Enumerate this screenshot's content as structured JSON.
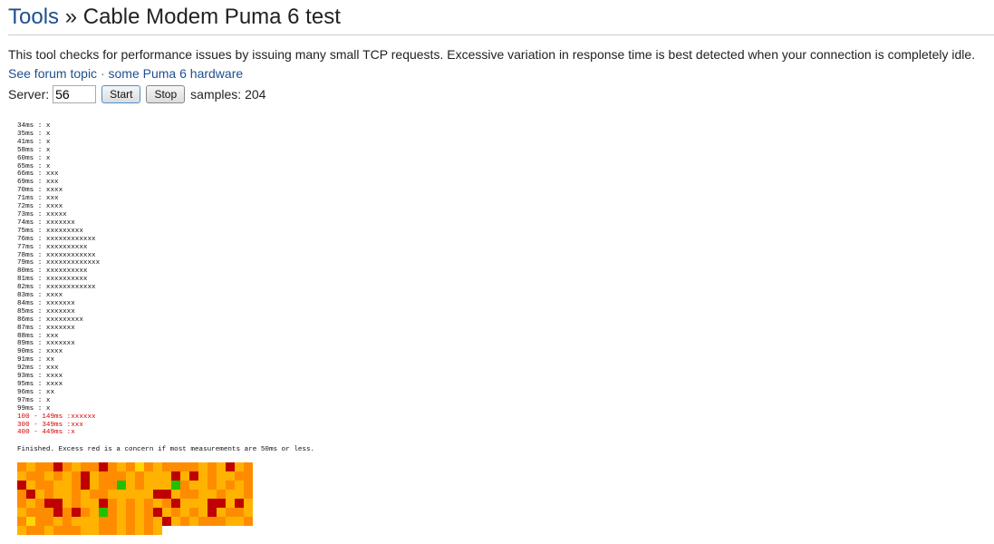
{
  "header": {
    "breadcrumb_link": "Tools",
    "separator": "»",
    "title": "Cable Modem Puma 6 test"
  },
  "description": "This tool checks for performance issues by issuing many small TCP requests. Excessive variation in response time is best detected when your connection is completely idle.",
  "links": {
    "forum": "See forum topic",
    "separator": "·",
    "hardware": "some Puma 6 hardware"
  },
  "controls": {
    "server_label": "Server:",
    "server_value": "56",
    "start_label": "Start",
    "stop_label": "Stop",
    "samples_text": "samples: 204"
  },
  "histogram": [
    {
      "ms": "34ms",
      "n": 1
    },
    {
      "ms": "35ms",
      "n": 1
    },
    {
      "ms": "41ms",
      "n": 1
    },
    {
      "ms": "58ms",
      "n": 1
    },
    {
      "ms": "60ms",
      "n": 1
    },
    {
      "ms": "65ms",
      "n": 1
    },
    {
      "ms": "66ms",
      "n": 3
    },
    {
      "ms": "69ms",
      "n": 3
    },
    {
      "ms": "70ms",
      "n": 4
    },
    {
      "ms": "71ms",
      "n": 3
    },
    {
      "ms": "72ms",
      "n": 4
    },
    {
      "ms": "73ms",
      "n": 5
    },
    {
      "ms": "74ms",
      "n": 7
    },
    {
      "ms": "75ms",
      "n": 9
    },
    {
      "ms": "76ms",
      "n": 12
    },
    {
      "ms": "77ms",
      "n": 10
    },
    {
      "ms": "78ms",
      "n": 12
    },
    {
      "ms": "79ms",
      "n": 13
    },
    {
      "ms": "80ms",
      "n": 10
    },
    {
      "ms": "81ms",
      "n": 10
    },
    {
      "ms": "82ms",
      "n": 12
    },
    {
      "ms": "83ms",
      "n": 4
    },
    {
      "ms": "84ms",
      "n": 7
    },
    {
      "ms": "85ms",
      "n": 7
    },
    {
      "ms": "86ms",
      "n": 9
    },
    {
      "ms": "87ms",
      "n": 7
    },
    {
      "ms": "88ms",
      "n": 3
    },
    {
      "ms": "89ms",
      "n": 7
    },
    {
      "ms": "90ms",
      "n": 4
    },
    {
      "ms": "91ms",
      "n": 2
    },
    {
      "ms": "92ms",
      "n": 3
    },
    {
      "ms": "93ms",
      "n": 4
    },
    {
      "ms": "95ms",
      "n": 4
    },
    {
      "ms": "96ms",
      "n": 2
    },
    {
      "ms": "97ms",
      "n": 1
    },
    {
      "ms": "99ms",
      "n": 1
    }
  ],
  "histogram_ranges": [
    {
      "label": "100 - 149ms",
      "n": 6
    },
    {
      "label": "300 - 349ms",
      "n": 3
    },
    {
      "label": "400 - 449ms",
      "n": 1
    }
  ],
  "finished_text": "Finished. Excess red is a concern if most measurements are 50ms or less.",
  "heatmap": {
    "colors": {
      "r": "#e01b00",
      "R": "#c00000",
      "o": "#ff6a00",
      "O": "#ff8c00",
      "y": "#ffb300",
      "Y": "#ffd700",
      "g": "#66e000",
      "G": "#22c000"
    },
    "rows": [
      "OyOOROyOOROyOYOyOOOOyOyRyOO",
      "yOOyOyORyOOOyOyyyRyRyOyyOO",
      "RyOOyyORyOOGyOyyyGOyyOyOyO",
      "ORyOyyOyOOyyyyyRRyOOyyOyyO",
      "OyORRyOyyROyOyOyORyyyRRyRyO",
      "yOOOROROyGOyOyORyOyOyRyOOy",
      "OYOOyOyyyOOyOyOyRyOyOOOyyO",
      "yOOyOOOyyOOyOyOy"
    ]
  }
}
